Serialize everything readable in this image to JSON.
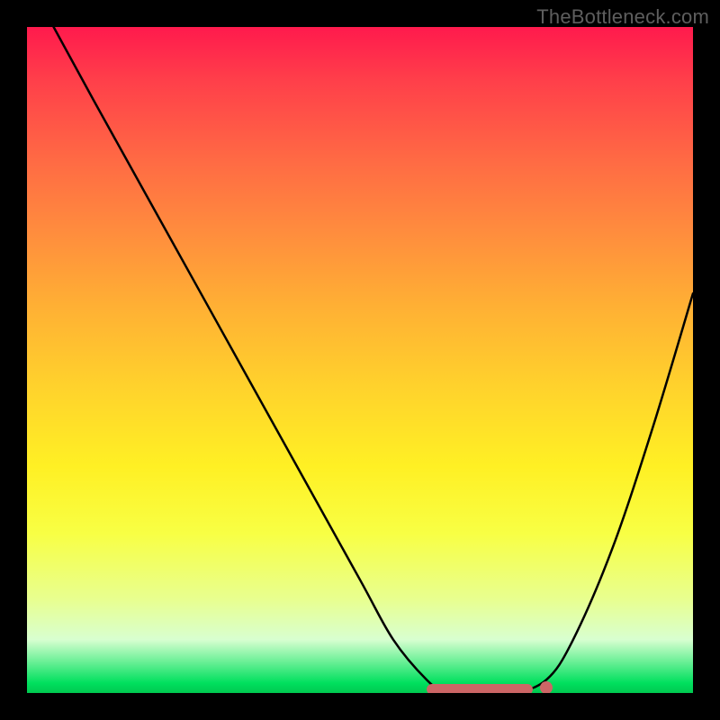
{
  "watermark": "TheBottleneck.com",
  "colors": {
    "frame": "#000000",
    "curve": "#000000",
    "bump": "#cc6666",
    "gradient_top": "#ff1a4d",
    "gradient_mid": "#fff024",
    "gradient_bottom": "#00c850"
  },
  "chart_data": {
    "type": "line",
    "title": "",
    "xlabel": "",
    "ylabel": "",
    "xlim": [
      0,
      100
    ],
    "ylim": [
      0,
      100
    ],
    "grid": false,
    "legend": false,
    "series": [
      {
        "name": "bottleneck-curve",
        "x": [
          4,
          10,
          20,
          30,
          40,
          50,
          55,
          60,
          63,
          67,
          73,
          78,
          82,
          88,
          94,
          100
        ],
        "y": [
          100,
          89,
          71,
          53,
          35,
          17,
          8,
          2,
          0,
          0,
          0,
          2,
          8,
          22,
          40,
          60
        ]
      }
    ],
    "annotations": [
      {
        "name": "sweet-spot-band",
        "x_start": 60,
        "x_end": 76,
        "y": 0
      },
      {
        "name": "sweet-spot-dot",
        "x": 78,
        "y": 0
      }
    ]
  }
}
